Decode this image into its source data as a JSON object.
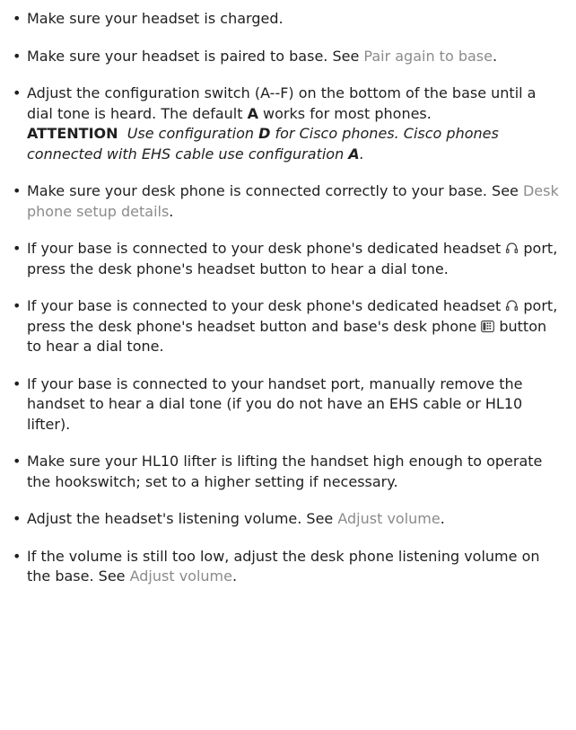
{
  "items": [
    {
      "text": "Make sure your headset is charged."
    },
    {
      "pre": "Make sure your headset is paired to base. See ",
      "link": "Pair again to base",
      "post": "."
    },
    {
      "pre": "Adjust the configuration switch (A--F) on the bottom of the base until a dial tone is heard. The default ",
      "bold": "A",
      "post": " works for most phones.",
      "note_label": "ATTENTION",
      "note_pre": "Use configuration ",
      "note_bold1": "D",
      "note_mid": " for Cisco phones. Cisco phones connected with EHS cable use configuration ",
      "note_bold2": "A",
      "note_post": "."
    },
    {
      "pre": "Make sure your desk phone is connected correctly to your base. See ",
      "link": "Desk phone setup details",
      "post": "."
    },
    {
      "pre": "If your base is connected to your desk phone's dedicated headset ",
      "post": "port, press the desk phone's headset button to hear a dial tone.",
      "icon": "headset-icon"
    },
    {
      "pre": "If your base is connected to your desk phone's dedicated headset ",
      "mid": "port, press the desk phone's headset button and base's desk phone ",
      "post": "button to hear a dial tone.",
      "icon1": "headset-icon",
      "icon2": "desk-phone-icon"
    },
    {
      "text": "If your base is connected to your handset port, manually remove the handset to hear a dial tone (if you do not have an EHS cable or HL10 lifter)."
    },
    {
      "text": "Make sure your HL10 lifter is lifting the handset high enough to operate the hookswitch; set to a higher setting if necessary."
    },
    {
      "pre": "Adjust the headset's listening volume. See ",
      "link": "Adjust volume",
      "post": "."
    },
    {
      "pre": "If the volume is still too low, adjust the desk phone listening volume on the base. See ",
      "link": "Adjust volume",
      "post": "."
    }
  ],
  "colors": {
    "text": "#1f1f1f",
    "link": "#8b8b8b"
  }
}
